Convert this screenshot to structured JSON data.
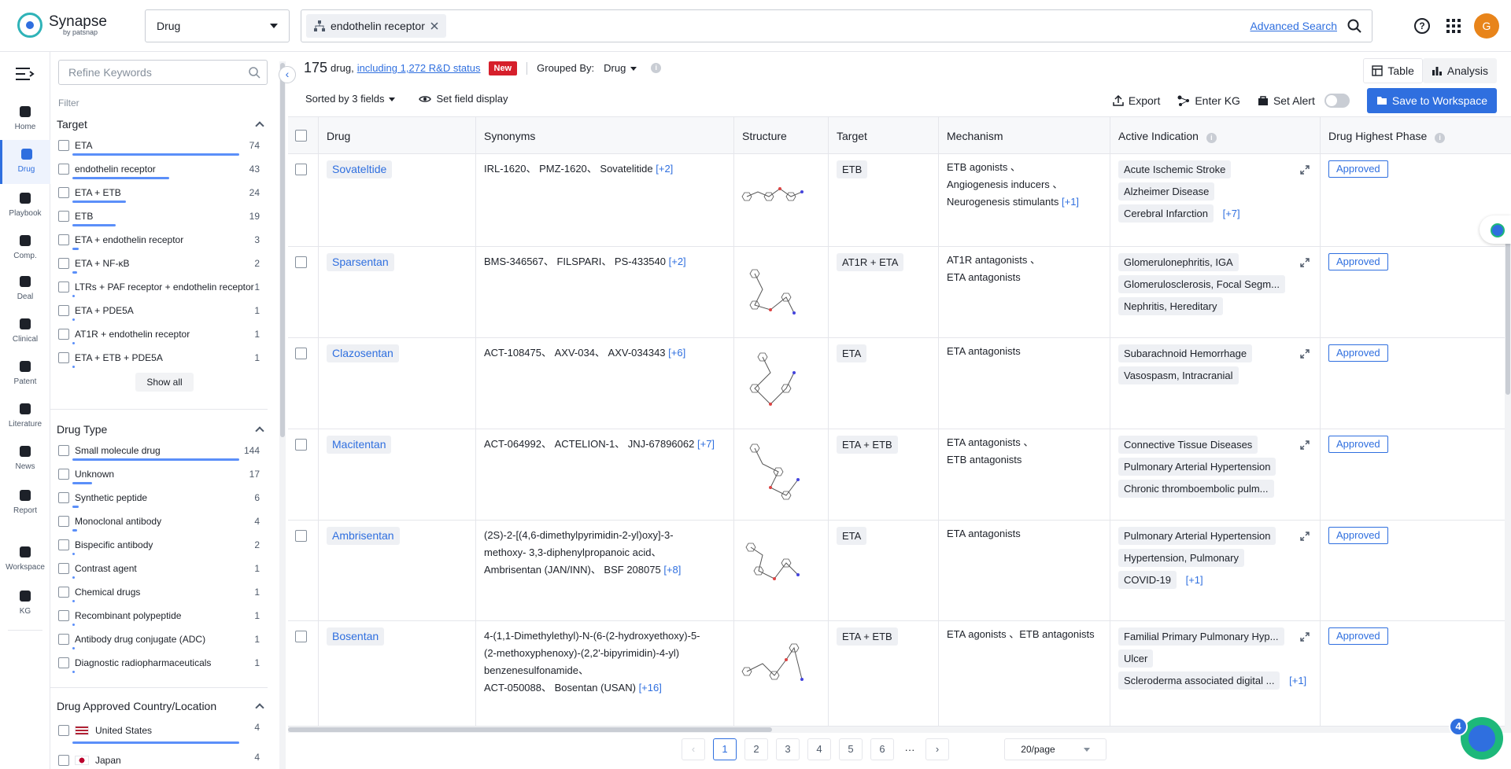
{
  "app": {
    "name": "Synapse",
    "sub": "by patsnap",
    "avatar": "G"
  },
  "search": {
    "type": "Drug",
    "chip": "endothelin receptor",
    "advanced": "Advanced Search"
  },
  "nav": [
    {
      "label": "Home",
      "icon": "home-icon"
    },
    {
      "label": "Drug",
      "icon": "drug-icon"
    },
    {
      "label": "Playbook",
      "icon": "playbook-icon"
    },
    {
      "label": "Comp.",
      "icon": "competition-icon"
    },
    {
      "label": "Deal",
      "icon": "deal-icon"
    },
    {
      "label": "Clinical",
      "icon": "clinical-icon"
    },
    {
      "label": "Patent",
      "icon": "patent-icon"
    },
    {
      "label": "Literature",
      "icon": "literature-icon"
    },
    {
      "label": "News",
      "icon": "news-icon"
    },
    {
      "label": "Report",
      "icon": "report-icon"
    },
    {
      "label": "Workspace",
      "icon": "workspace-icon"
    },
    {
      "label": "KG",
      "icon": "kg-icon"
    }
  ],
  "filter": {
    "placeholder": "Refine Keywords",
    "label": "Filter",
    "target": {
      "title": "Target",
      "items": [
        {
          "label": "ETA",
          "count": "74",
          "frac": 1.0
        },
        {
          "label": "endothelin receptor",
          "count": "43",
          "frac": 0.58
        },
        {
          "label": "ETA + ETB",
          "count": "24",
          "frac": 0.32
        },
        {
          "label": "ETB",
          "count": "19",
          "frac": 0.26
        },
        {
          "label": "ETA + endothelin receptor",
          "count": "3",
          "frac": 0.04
        },
        {
          "label": "ETA + NF-κB",
          "count": "2",
          "frac": 0.03
        },
        {
          "label": "LTRs + PAF receptor + endothelin receptor",
          "count": "1",
          "frac": 0.015
        },
        {
          "label": "ETA + PDE5A",
          "count": "1",
          "frac": 0.015
        },
        {
          "label": "AT1R + endothelin receptor",
          "count": "1",
          "frac": 0.015
        },
        {
          "label": "ETA + ETB + PDE5A",
          "count": "1",
          "frac": 0.015
        }
      ],
      "show_all": "Show all"
    },
    "drug_type": {
      "title": "Drug Type",
      "items": [
        {
          "label": "Small molecule drug",
          "count": "144",
          "frac": 1.0
        },
        {
          "label": "Unknown",
          "count": "17",
          "frac": 0.12
        },
        {
          "label": "Synthetic peptide",
          "count": "6",
          "frac": 0.04
        },
        {
          "label": "Monoclonal antibody",
          "count": "4",
          "frac": 0.03
        },
        {
          "label": "Bispecific antibody",
          "count": "2",
          "frac": 0.015
        },
        {
          "label": "Contrast agent",
          "count": "1",
          "frac": 0.01
        },
        {
          "label": "Chemical drugs",
          "count": "1",
          "frac": 0.01
        },
        {
          "label": "Recombinant polypeptide",
          "count": "1",
          "frac": 0.01
        },
        {
          "label": "Antibody drug conjugate (ADC)",
          "count": "1",
          "frac": 0.01
        },
        {
          "label": "Diagnostic radiopharmaceuticals",
          "count": "1",
          "frac": 0.01
        }
      ]
    },
    "country": {
      "title": "Drug Approved Country/Location",
      "items": [
        {
          "label": "United States",
          "count": "4",
          "frac": 1.0,
          "flag": "us-flag-icon"
        },
        {
          "label": "Japan",
          "count": "4",
          "frac": 1.0,
          "flag": "japan-flag-icon"
        }
      ]
    }
  },
  "summary": {
    "count": "175",
    "unit": "drug,",
    "rd_link": "including 1,272 R&D status",
    "new": "New",
    "grouped_label": "Grouped By:",
    "grouped_value": "Drug"
  },
  "views": {
    "table": "Table",
    "analysis": "Analysis"
  },
  "toolbar": {
    "sorted": "Sorted by 3 fields",
    "field_display": "Set field display",
    "export": "Export",
    "enter_kg": "Enter KG",
    "set_alert": "Set Alert",
    "save": "Save to Workspace"
  },
  "columns": [
    "Drug",
    "Synonyms",
    "Structure",
    "Target",
    "Mechanism",
    "Active Indication",
    "Drug Highest Phase"
  ],
  "rows": [
    {
      "drug": "Sovateltide",
      "synonyms": [
        "IRL-1620、 PMZ-1620、 Sovatelitide"
      ],
      "syn_more": "[+2]",
      "target": "ETB",
      "mechanism": [
        "ETB agonists 、",
        "Angiogenesis inducers 、",
        "Neurogenesis stimulants"
      ],
      "mech_more": "[+1]",
      "indications": [
        "Acute Ischemic Stroke",
        "Alzheimer Disease",
        "Cerebral Infarction"
      ],
      "ind_more": "[+7]",
      "phase": "Approved"
    },
    {
      "drug": "Sparsentan",
      "synonyms": [
        "BMS-346567、 FILSPARI、 PS-433540"
      ],
      "syn_more": "[+2]",
      "target": "AT1R + ETA",
      "mechanism": [
        "AT1R antagonists 、",
        "ETA antagonists"
      ],
      "mech_more": "",
      "indications": [
        "Glomerulonephritis, IGA",
        "Glomerulosclerosis, Focal Segm...",
        "Nephritis, Hereditary"
      ],
      "ind_more": "",
      "phase": "Approved"
    },
    {
      "drug": "Clazosentan",
      "synonyms": [
        "ACT-108475、 AXV-034、 AXV-034343"
      ],
      "syn_more": "[+6]",
      "target": "ETA",
      "mechanism": [
        "ETA antagonists"
      ],
      "mech_more": "",
      "indications": [
        "Subarachnoid Hemorrhage",
        "Vasospasm, Intracranial"
      ],
      "ind_more": "",
      "phase": "Approved"
    },
    {
      "drug": "Macitentan",
      "synonyms": [
        "ACT-064992、 ACTELION-1、 JNJ-67896062"
      ],
      "syn_more": "[+7]",
      "target": "ETA + ETB",
      "mechanism": [
        "ETA antagonists 、",
        "ETB antagonists"
      ],
      "mech_more": "",
      "indications": [
        "Connective Tissue Diseases",
        "Pulmonary Arterial Hypertension",
        "Chronic thromboembolic pulm..."
      ],
      "ind_more": "",
      "phase": "Approved"
    },
    {
      "drug": "Ambrisentan",
      "synonyms": [
        "(2S)-2-[(4,6-dimethylpyrimidin-2-yl)oxy]-3-",
        "methoxy- 3,3-diphenylpropanoic acid、",
        "Ambrisentan (JAN/INN)、 BSF 208075"
      ],
      "syn_more": "[+8]",
      "target": "ETA",
      "mechanism": [
        "ETA antagonists"
      ],
      "mech_more": "",
      "indications": [
        "Pulmonary Arterial Hypertension",
        "Hypertension, Pulmonary",
        "COVID-19"
      ],
      "ind_more": "[+1]",
      "phase": "Approved"
    },
    {
      "drug": "Bosentan",
      "synonyms": [
        "4-(1,1-Dimethylethyl)-N-(6-(2-hydroxyethoxy)-5-",
        "(2-methoxyphenoxy)-(2,2'-bipyrimidin)-4-yl)",
        "benzenesulfonamide、",
        "ACT-050088、 Bosentan (USAN)"
      ],
      "syn_more": "[+16]",
      "target": "ETA + ETB",
      "mechanism": [
        "ETA agonists 、ETB antagonists"
      ],
      "mech_more": "",
      "indications": [
        "Familial Primary Pulmonary Hyp...",
        "Ulcer",
        "Scleroderma associated digital ..."
      ],
      "ind_more": "[+1]",
      "phase": "Approved"
    }
  ],
  "pager": {
    "pages": [
      "1",
      "2",
      "3",
      "4",
      "5",
      "6"
    ],
    "ellipsis": "···",
    "current": "1",
    "size": "20/page"
  },
  "notify_count": "4"
}
